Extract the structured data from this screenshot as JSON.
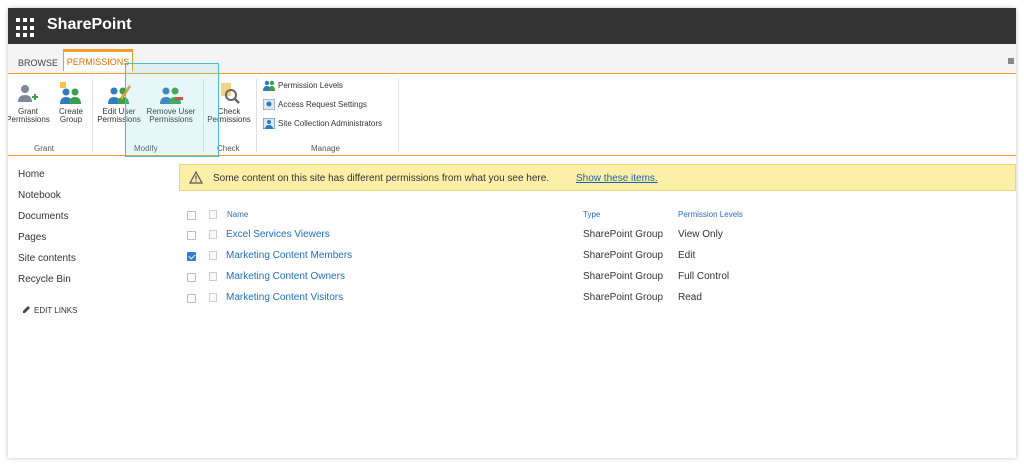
{
  "suite": {
    "brand": "SharePoint"
  },
  "tabs": {
    "browse": "BROWSE",
    "permissions": "PERMISSIONS"
  },
  "ribbon": {
    "grant": {
      "grant_permissions": [
        "Grant",
        "Permissions"
      ],
      "create_group": [
        "Create",
        "Group"
      ],
      "label": "Grant"
    },
    "modify": {
      "edit_user": [
        "Edit User",
        "Permissions"
      ],
      "remove_user": [
        "Remove User",
        "Permissions"
      ],
      "label": "Modify"
    },
    "check": {
      "check_permissions": [
        "Check",
        "Permissions"
      ],
      "label": "Check"
    },
    "manage": {
      "items": [
        "Permission Levels",
        "Access Request Settings",
        "Site Collection Administrators"
      ],
      "label": "Manage"
    }
  },
  "nav": {
    "items": [
      "Home",
      "Notebook",
      "Documents",
      "Pages",
      "Site contents",
      "Recycle Bin"
    ],
    "edit_links": "EDIT LINKS"
  },
  "banner": {
    "message": "Some content on this site has different permissions from what you see here.",
    "link": "Show these items."
  },
  "table": {
    "headers": {
      "name": "Name",
      "type": "Type",
      "levels": "Permission Levels"
    },
    "rows": [
      {
        "name": "Excel Services Viewers",
        "type": "SharePoint Group",
        "level": "View Only",
        "checked": false
      },
      {
        "name": "Marketing Content Members",
        "type": "SharePoint Group",
        "level": "Edit",
        "checked": true
      },
      {
        "name": "Marketing Content Owners",
        "type": "SharePoint Group",
        "level": "Full Control",
        "checked": false
      },
      {
        "name": "Marketing Content Visitors",
        "type": "SharePoint Group",
        "level": "Read",
        "checked": false
      }
    ]
  },
  "colors": {
    "suitebar": "#333333",
    "accent": "#f39c2e",
    "link": "#1f6fbf",
    "banner": "#fcf0a9",
    "selection": "#4cbfc2"
  }
}
